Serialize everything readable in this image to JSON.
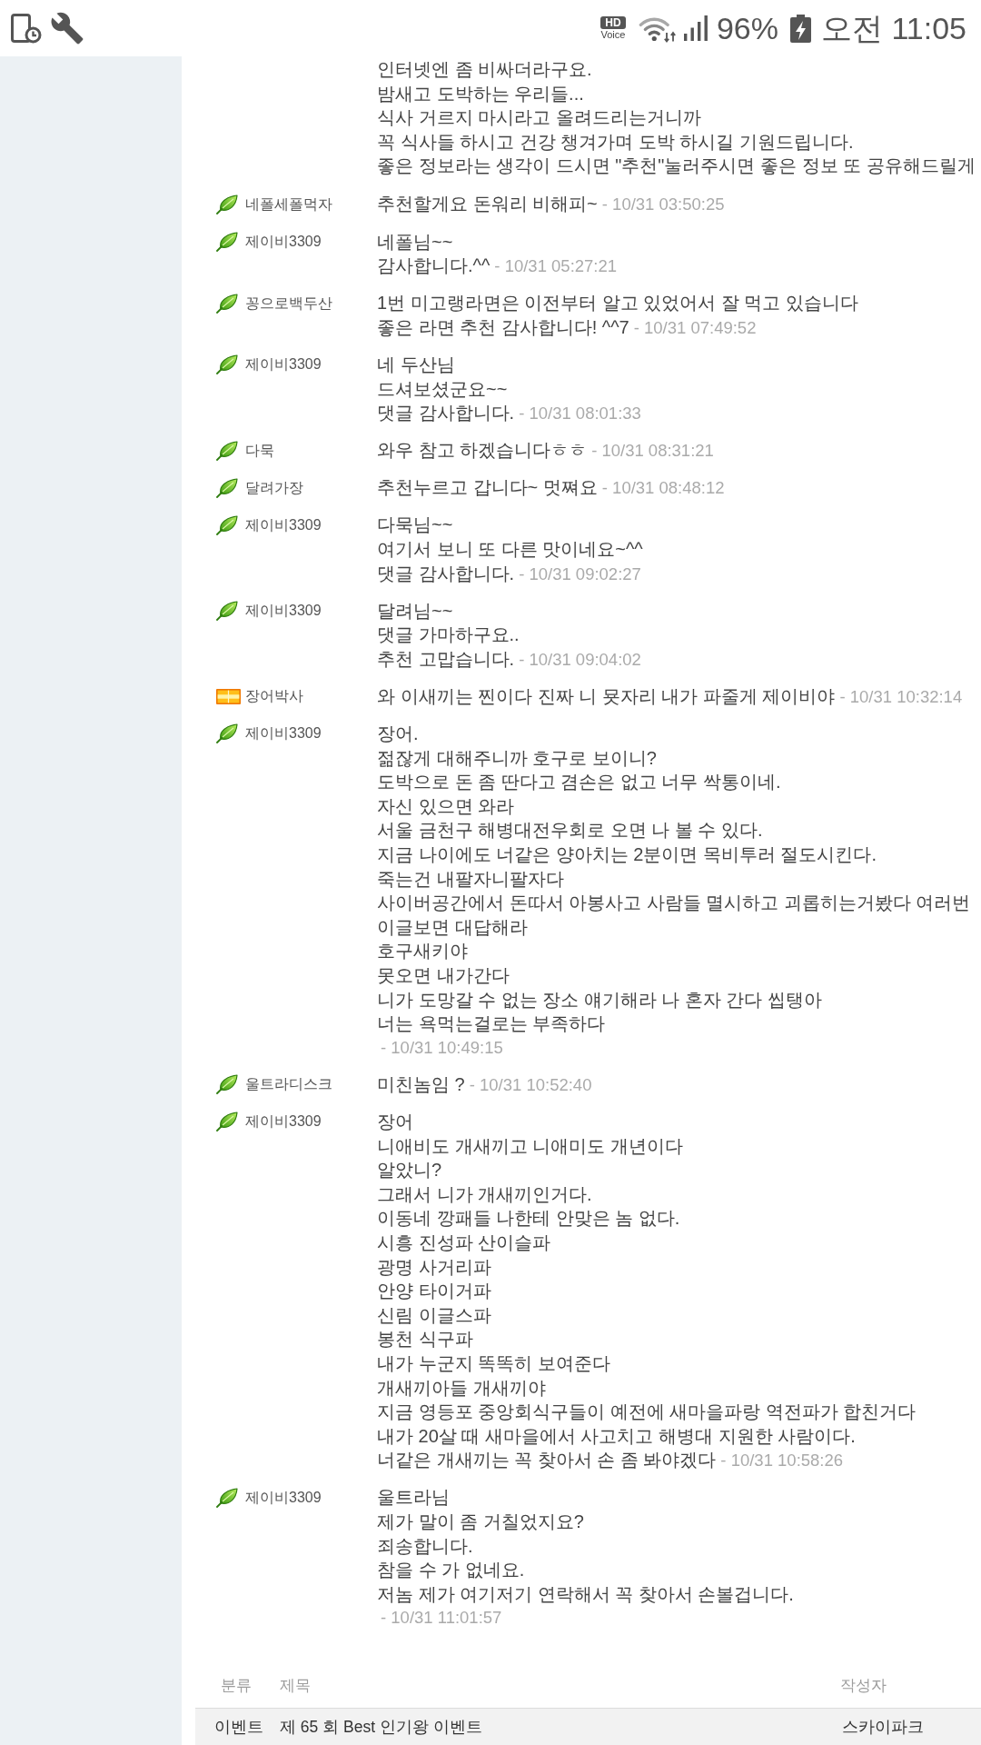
{
  "status_bar": {
    "hd_badge": "HD",
    "hd_label": "Voice",
    "battery_text": "96%",
    "time": "오전 11:05"
  },
  "comment_tail": {
    "lines": [
      "인터넷엔 좀 비싸더라구요.",
      "밤새고 도박하는 우리들...",
      "식사 거르지 마시라고 올려드리는거니까",
      "꼭 식사들 하시고 건강 챙겨가며 도박 하시길 기원드립니다.",
      "좋은 정보라는 생각이 드시면 \"추천\"눌러주시면 좋은 정보 또 공유해드릴게"
    ]
  },
  "comments": [
    {
      "author": "네폴세폴먹자",
      "rank_icon": {
        "kind": "leaf"
      },
      "lines": [
        "추천할게요 돈워리 비해피~"
      ],
      "time": "- 10/31 03:50:25",
      "time_on_new_line": false
    },
    {
      "author": "제이비3309",
      "rank_icon": {
        "kind": "leaf"
      },
      "lines": [
        "네폴님~~",
        "감사합니다.^^"
      ],
      "time": "- 10/31 05:27:21",
      "time_on_new_line": false
    },
    {
      "author": "꽁으로백두산",
      "rank_icon": {
        "kind": "leaf"
      },
      "lines": [
        "1번 미고랭라면은 이전부터 알고 있었어서 잘 먹고 있습니다",
        "좋은 라면 추천 감사합니다! ^^7"
      ],
      "time": "- 10/31 07:49:52",
      "time_on_new_line": false
    },
    {
      "author": "제이비3309",
      "rank_icon": {
        "kind": "leaf"
      },
      "lines": [
        "네 두산님",
        "드셔보셨군요~~",
        "댓글 감사합니다."
      ],
      "time": "- 10/31 08:01:33",
      "time_on_new_line": false
    },
    {
      "author": "다묵",
      "rank_icon": {
        "kind": "leaf"
      },
      "lines": [
        "와우 참고 하겠습니다ㅎㅎ"
      ],
      "time": "- 10/31 08:31:21",
      "time_on_new_line": false
    },
    {
      "author": "달려가장",
      "rank_icon": {
        "kind": "leaf"
      },
      "lines": [
        "추천누르고 갑니다~ 멋쪄요"
      ],
      "time": "- 10/31 08:48:12",
      "time_on_new_line": false
    },
    {
      "author": "제이비3309",
      "rank_icon": {
        "kind": "leaf"
      },
      "lines": [
        "다묵님~~",
        "여기서 보니 또 다른 맛이네요~^^",
        "댓글 감사합니다."
      ],
      "time": "- 10/31 09:02:27",
      "time_on_new_line": false
    },
    {
      "author": "제이비3309",
      "rank_icon": {
        "kind": "leaf"
      },
      "lines": [
        "달려님~~",
        "댓글 가마하구요..",
        "추천 고맙습니다."
      ],
      "time": "- 10/31 09:04:02",
      "time_on_new_line": false
    },
    {
      "author": "장어박사",
      "rank_icon": {
        "kind": "bar"
      },
      "lines": [
        "와 이새끼는 찐이다 진짜 니 묫자리 내가 파줄게 제이비야"
      ],
      "time": "- 10/31 10:32:14",
      "time_on_new_line": false
    },
    {
      "author": "제이비3309",
      "rank_icon": {
        "kind": "leaf"
      },
      "lines": [
        "장어.",
        "젊잖게 대해주니까 호구로 보이니?",
        "도박으로 돈 좀 딴다고 겸손은 없고 너무 싹통이네.",
        "자신 있으면 와라",
        "서울 금천구 해병대전우회로 오면 나 볼 수 있다.",
        "지금 나이에도 너같은 양아치는 2분이면 목비투러 절도시킨다.",
        "죽는건 내팔자니팔자다",
        "사이버공간에서 돈따서 아봉사고 사람들 멸시하고 괴롭히는거봤다 여러번",
        "이글보면 대답해라",
        "호구새키야",
        "못오면 내가간다",
        "니가 도망갈 수 없는 장소 얘기해라 나 혼자 간다 씹탱아",
        "너는 욕먹는걸로는 부족하다"
      ],
      "time": "- 10/31 10:49:15",
      "time_on_new_line": true
    },
    {
      "author": "울트라디스크",
      "rank_icon": {
        "kind": "leaf"
      },
      "lines": [
        "미친놈임 ?"
      ],
      "time": "- 10/31 10:52:40",
      "time_on_new_line": false
    },
    {
      "author": "제이비3309",
      "rank_icon": {
        "kind": "leaf"
      },
      "lines": [
        "장어",
        "니애비도 개새끼고 니애미도 개년이다",
        "알았니?",
        "그래서 니가 개새끼인거다.",
        "이동네 깡패들 나한테 안맞은 놈 없다.",
        "시흥 진성파 산이슬파",
        "광명 사거리파",
        "안양 타이거파",
        "신림 이글스파",
        "봉천 식구파",
        "내가 누군지 똑똑히 보여준다",
        "개새끼아들 개새끼야",
        "지금 영등포 중앙회식구들이 예전에 새마을파랑 역전파가 합친거다",
        "내가 20살 때 새마을에서 사고치고 해병대 지원한 사람이다.",
        "너같은 개새끼는 꼭 찾아서 손 좀 봐야겠다"
      ],
      "time": "- 10/31 10:58:26",
      "time_on_new_line": false
    },
    {
      "author": "제이비3309",
      "rank_icon": {
        "kind": "leaf"
      },
      "lines": [
        "울트라님",
        "제가 말이 좀 거칠었지요?",
        "죄송합니다.",
        "참을 수 가 없네요.",
        "저놈 제가 여기저기 연락해서 꼭 찾아서 손볼겁니다."
      ],
      "time": "- 10/31 11:01:57",
      "time_on_new_line": true
    }
  ],
  "board_table": {
    "columns": [
      "분류",
      "제목",
      "작성자"
    ],
    "rows": [
      {
        "category": "이벤트",
        "title": "제 65 회 Best 인기왕 이벤트",
        "author": "스카이파크"
      }
    ]
  }
}
